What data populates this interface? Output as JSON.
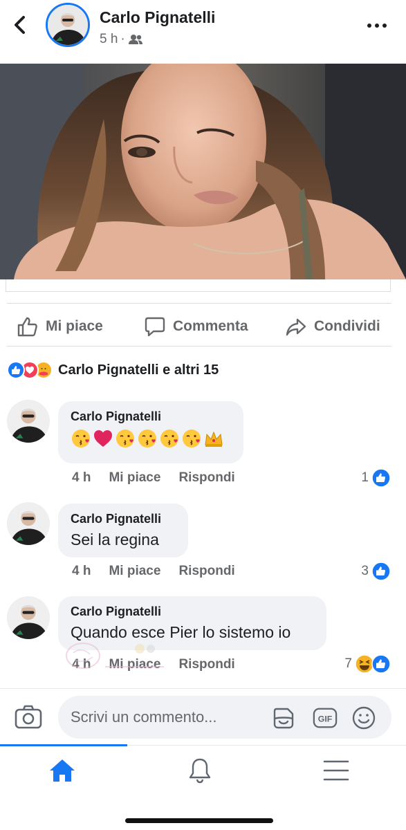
{
  "post": {
    "author": "Carlo Pignatelli",
    "time": "5 h",
    "separator": "·",
    "audience_icon": "friends-icon"
  },
  "actions": {
    "like": "Mi piace",
    "comment": "Commenta",
    "share": "Condividi"
  },
  "reactions": {
    "icons": [
      "like-reaction-icon",
      "love-reaction-icon",
      "care-reaction-icon"
    ],
    "summary": "Carlo Pignatelli e altri 15"
  },
  "comments": [
    {
      "author": "Carlo Pignatelli",
      "text": "",
      "emojis": [
        "kiss-emoji",
        "heart-emoji",
        "kiss-emoji",
        "kiss-emoji",
        "kiss-emoji",
        "kiss-emoji",
        "crown-emoji"
      ],
      "time": "4 h",
      "like": "Mi piace",
      "reply": "Rispondi",
      "reaction_count": "1",
      "reaction_icons": [
        "like-reaction-icon"
      ]
    },
    {
      "author": "Carlo Pignatelli",
      "text": "Sei la regina",
      "time": "4 h",
      "like": "Mi piace",
      "reply": "Rispondi",
      "reaction_count": "3",
      "reaction_icons": [
        "like-reaction-icon"
      ]
    },
    {
      "author": "Carlo Pignatelli",
      "text": "Quando esce Pier lo sistemo io",
      "time": "4 h",
      "like": "Mi piace",
      "reply": "Rispondi",
      "reaction_count": "7",
      "reaction_icons": [
        "haha-reaction-icon",
        "like-reaction-icon"
      ]
    }
  ],
  "composer": {
    "placeholder": "Scrivi un commento..."
  },
  "tabs": [
    "home-icon",
    "notifications-icon",
    "menu-icon"
  ],
  "colors": {
    "accent": "#1877f2",
    "love": "#f33e58",
    "haha": "#f7b125",
    "text": "#1c1e21",
    "muted": "#65676b",
    "bubble": "#f0f2f5"
  }
}
